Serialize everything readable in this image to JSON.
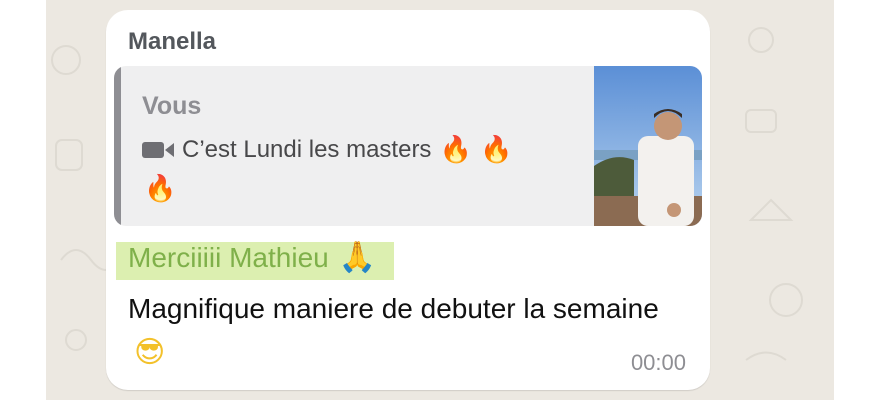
{
  "chat": {
    "sender_name": "Manella",
    "reply": {
      "author": "Vous",
      "media_icon": "video-camera-icon",
      "text": "C’est Lundi les masters",
      "emoji_inline": "🔥 🔥",
      "emoji_wrap": "🔥",
      "thumbnail": "video-thumbnail"
    },
    "message_line1": "Merciiiii Mathieu",
    "message_line1_emoji": "🙏",
    "message_body": "Magnifique maniere de debuter la semaine",
    "message_body_emoji": "😎",
    "timestamp": "00:00"
  },
  "colors": {
    "highlight": "#dcefb0",
    "highlight_text": "#7fb04a",
    "quote_bar": "#8e8e93"
  }
}
